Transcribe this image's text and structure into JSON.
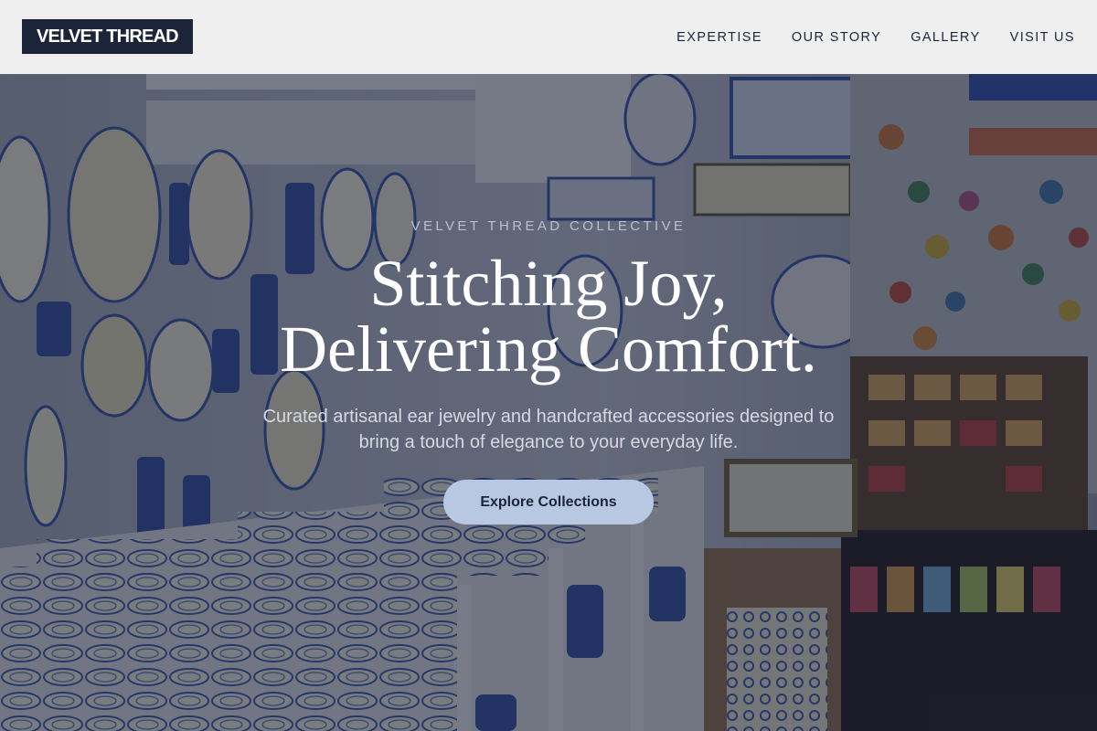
{
  "header": {
    "logo_text": "VELVET THREAD",
    "nav": [
      {
        "label": "EXPERTISE"
      },
      {
        "label": "OUR STORY"
      },
      {
        "label": "GALLERY"
      },
      {
        "label": "VISIT US"
      }
    ]
  },
  "hero": {
    "eyebrow": "VELVET THREAD COLLECTIVE",
    "headline_line1": "Stitching Joy,",
    "headline_line2": "Delivering Comfort.",
    "subheadline": "Curated artisanal ear jewelry and handcrafted accessories designed to bring a touch of elegance to your everyday life.",
    "cta_label": "Explore Collections"
  },
  "colors": {
    "header_bg": "#efeff0",
    "logo_bg": "#1c2438",
    "nav_text": "#1c2438",
    "cta_bg": "#b8c8e2",
    "cta_text": "#1c2438",
    "headline_text": "#ffffff"
  }
}
